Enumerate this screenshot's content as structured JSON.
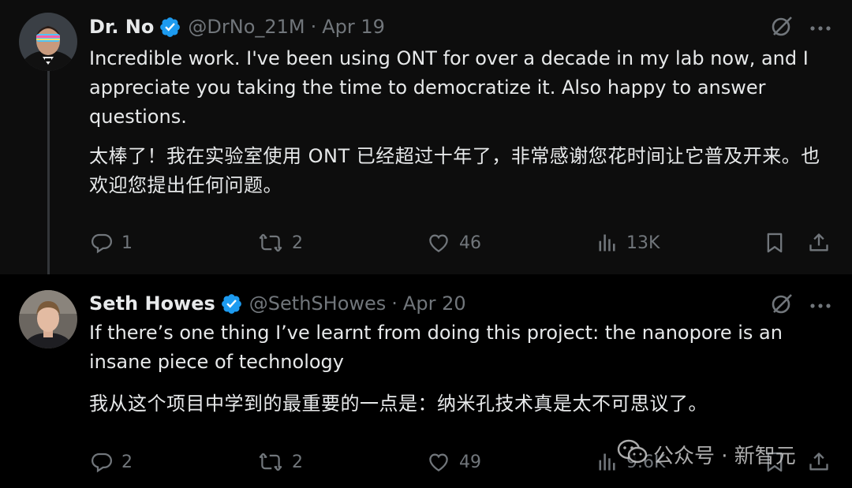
{
  "tweets": [
    {
      "display_name": "Dr. No",
      "handle": "@DrNo_21M",
      "separator": "·",
      "date": "Apr 19",
      "text_en": "Incredible work. I've been using ONT for over a decade in my lab now, and I appreciate you taking the time to democratize it. Also happy to answer questions.",
      "text_zh": "太棒了！我在实验室使用 ONT 已经超过十年了，非常感谢您花时间让它普及开来。也欢迎您提出任何问题。",
      "actions": {
        "replies": "1",
        "reposts": "2",
        "likes": "46",
        "views": "13K"
      }
    },
    {
      "display_name": "Seth Howes",
      "handle": "@SethSHowes",
      "separator": "·",
      "date": "Apr 20",
      "text_en": "If there’s one thing I’ve learnt from doing this project: the nanopore is an insane piece of technology",
      "text_zh": "我从这个项目中学到的最重要的一点是：纳米孔技术真是太不可思议了。",
      "actions": {
        "replies": "2",
        "reposts": "2",
        "likes": "49",
        "views": "9.6K"
      }
    }
  ],
  "watermark": {
    "text": "公众号 · 新智元",
    "logo_icon": "wechat-icon"
  },
  "colors": {
    "background": "#000000",
    "first_tweet_background": "#0d0d0d",
    "text_primary": "#e7e9ea",
    "text_secondary": "#71767b",
    "verified_blue": "#1d9bf0"
  }
}
